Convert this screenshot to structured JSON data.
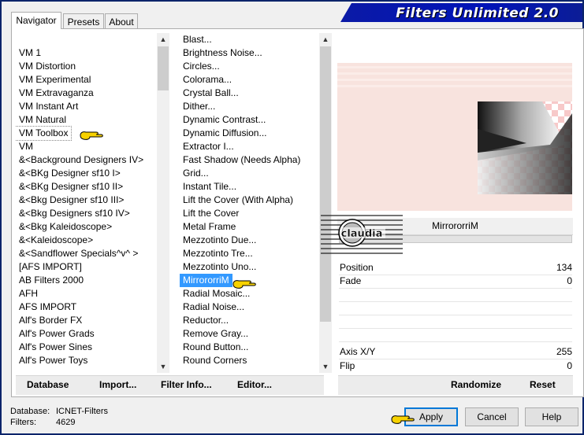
{
  "app": {
    "title": "Filters Unlimited 2.0"
  },
  "tabs": [
    {
      "label": "Navigator",
      "active": true
    },
    {
      "label": "Presets",
      "active": false
    },
    {
      "label": "About",
      "active": false
    }
  ],
  "categories": [
    "VM 1",
    "VM Distortion",
    "VM Experimental",
    "VM Extravaganza",
    "VM Instant Art",
    "VM Natural",
    "VM Toolbox",
    "VM",
    "&<Background Designers IV>",
    "&<BKg Designer sf10 I>",
    "&<BKg Designer sf10 II>",
    "&<Bkg Designer sf10 III>",
    "&<Bkg Designers sf10 IV>",
    "&<Bkg Kaleidoscope>",
    "&<Kaleidoscope>",
    "&<Sandflower Specials^v^ >",
    "[AFS IMPORT]",
    "AB Filters 2000",
    "AFH",
    "AFS IMPORT",
    "Alf's Border FX",
    "Alf's Power Grads",
    "Alf's Power Sines",
    "Alf's Power Toys"
  ],
  "selected_category": "VM Toolbox",
  "filters": [
    "Blast...",
    "Brightness Noise...",
    "Circles...",
    "Colorama...",
    "Crystal Ball...",
    "Dither...",
    "Dynamic Contrast...",
    "Dynamic Diffusion...",
    "Extractor I...",
    "Fast Shadow (Needs Alpha)",
    "Grid...",
    "Instant Tile...",
    "Lift the Cover (With Alpha)",
    "Lift the Cover",
    "Metal Frame",
    "Mezzotinto Due...",
    "Mezzotinto Tre...",
    "Mezzotinto Uno...",
    "MirrororriM",
    "Radial Mosaic...",
    "Radial Noise...",
    "Reductor...",
    "Remove Gray...",
    "Round Button...",
    "Round Corners"
  ],
  "selected_filter": "MirrororriM",
  "toolbar": {
    "database": "Database",
    "import": "Import...",
    "filter_info": "Filter Info...",
    "editor": "Editor..."
  },
  "preview": {
    "filter_name": "MirrororriM",
    "watermark": "claudia"
  },
  "params": [
    {
      "name": "Position",
      "value": "134"
    },
    {
      "name": "Fade",
      "value": "0"
    },
    {
      "name": "Axis X/Y",
      "value": "255"
    },
    {
      "name": "Flip",
      "value": "0"
    }
  ],
  "right_toolbar": {
    "randomize": "Randomize",
    "reset": "Reset"
  },
  "footer": {
    "database_label": "Database:",
    "database_value": "ICNET-Filters",
    "filters_label": "Filters:",
    "filters_value": "4629"
  },
  "buttons": {
    "apply": "Apply",
    "cancel": "Cancel",
    "help": "Help"
  },
  "colors": {
    "selection": "#3399ff",
    "banner": "#0013b8",
    "pointer_hand": "#f7d200"
  }
}
